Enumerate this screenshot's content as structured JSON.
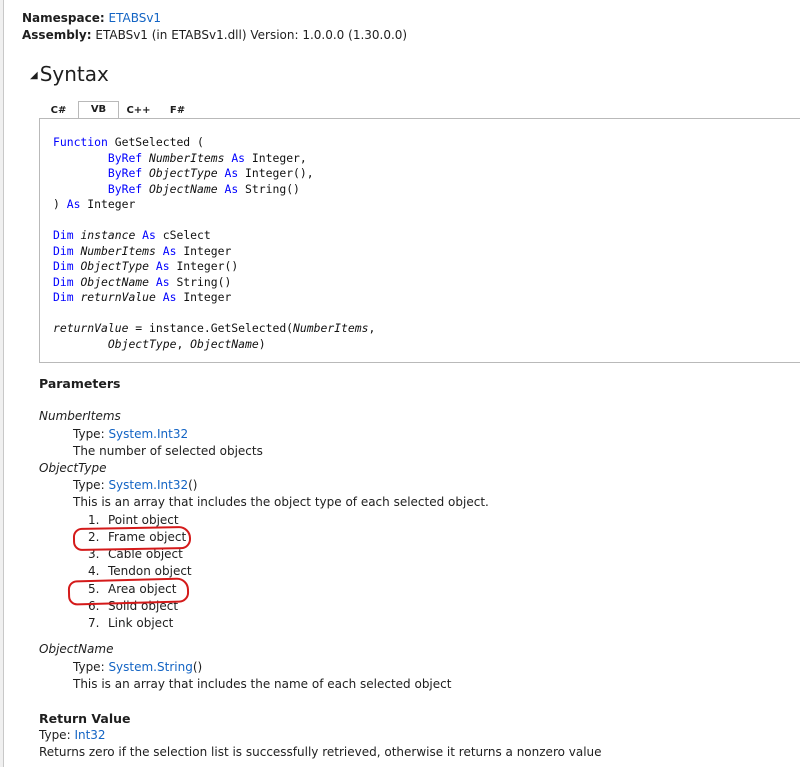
{
  "header": {
    "namespace_label": "Namespace:",
    "namespace_value": "ETABSv1",
    "assembly_label": "Assembly:",
    "assembly_value": "ETABSv1 (in ETABSv1.dll) Version: 1.0.0.0 (1.30.0.0)"
  },
  "syntax": {
    "heading": "Syntax",
    "tabs": [
      {
        "label": "C#",
        "active": false
      },
      {
        "label": "VB",
        "active": true
      },
      {
        "label": "C++",
        "active": false
      },
      {
        "label": "F#",
        "active": false
      }
    ],
    "code_tokens": {
      "function": "Function",
      "getselected": "GetSelected",
      "byref": "ByRef",
      "as": "As",
      "integer": "Integer",
      "integer_arr": "Integer()",
      "string_arr": "String()",
      "dim": "Dim",
      "instance": "instance",
      "cselect": "cSelect",
      "numberitems": "NumberItems",
      "objecttype": "ObjectType",
      "objectname": "ObjectName",
      "returnvalue": "returnValue",
      "call": "instance.GetSelected("
    }
  },
  "parameters": {
    "title": "Parameters",
    "items": [
      {
        "name": "NumberItems",
        "type_label": "Type:",
        "type_value": "System.Int32",
        "type_suffix": "",
        "description": "The number of selected objects"
      },
      {
        "name": "ObjectType",
        "type_label": "Type:",
        "type_value": "System.Int32",
        "type_suffix": "()",
        "description": "This is an array that includes the object type of each selected object."
      },
      {
        "name": "ObjectName",
        "type_label": "Type:",
        "type_value": "System.String",
        "type_suffix": "()",
        "description": "This is an array that includes the name of each selected object"
      }
    ],
    "object_types": [
      {
        "num": "1.",
        "label": "Point object"
      },
      {
        "num": "2.",
        "label": "Frame object"
      },
      {
        "num": "3.",
        "label": "Cable object"
      },
      {
        "num": "4.",
        "label": "Tendon object"
      },
      {
        "num": "5.",
        "label": "Area object"
      },
      {
        "num": "6.",
        "label": "Solid object"
      },
      {
        "num": "7.",
        "label": "Link object"
      }
    ]
  },
  "return_value": {
    "title": "Return Value",
    "type_label": "Type:",
    "type_value": "Int32",
    "description": "Returns zero if the selection list is successfully retrieved, otherwise it returns a nonzero value"
  },
  "colors": {
    "link": "#1364c4",
    "keyword": "#0000ff",
    "annotation": "#d41a1a"
  }
}
